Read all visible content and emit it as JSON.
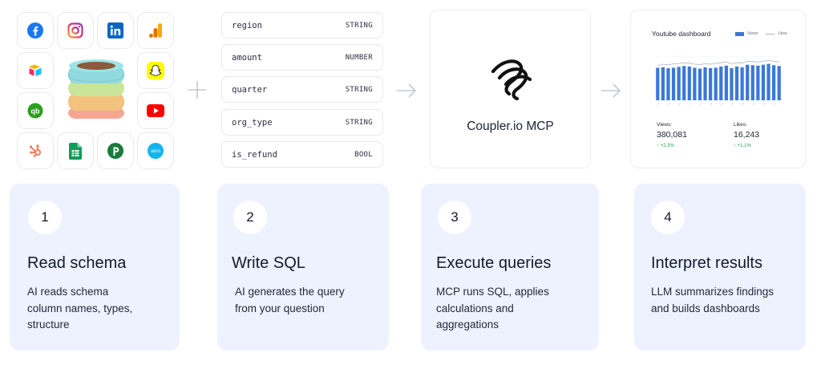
{
  "schema_fields": [
    {
      "name": "region",
      "type": "STRING"
    },
    {
      "name": "amount",
      "type": "NUMBER"
    },
    {
      "name": "quarter",
      "type": "STRING"
    },
    {
      "name": "org_type",
      "type": "STRING"
    },
    {
      "name": "is_refund",
      "type": "BOOL"
    }
  ],
  "source_icons": [
    "facebook-icon",
    "instagram-icon",
    "linkedin-icon",
    "google-analytics-icon",
    "airtable-icon",
    "snapchat-icon",
    "quickbooks-icon",
    "youtube-icon",
    "hubspot-icon",
    "google-sheets-icon",
    "pipedrive-icon",
    "xero-icon"
  ],
  "mcp": {
    "name": "Coupler.io MCP"
  },
  "dashboard": {
    "title": "Youtube dashboard",
    "legend": {
      "views": "Views",
      "likes": "Likes"
    },
    "views_label": "Views:",
    "views_value": "380,081",
    "views_delta": "↑ +2.3%",
    "likes_label": "Likes:",
    "likes_value": "16,243",
    "likes_delta": "↑ +1.1%"
  },
  "chart_data": {
    "type": "bar",
    "title": "Youtube dashboard",
    "series": [
      {
        "name": "Views",
        "values": [
          150,
          152,
          148,
          150,
          154,
          158,
          156,
          150,
          146,
          152,
          148,
          150,
          156,
          160,
          148,
          156,
          152,
          164,
          162,
          160,
          164,
          168,
          162,
          158
        ]
      },
      {
        "name": "Likes",
        "values": [
          480,
          500,
          490,
          505,
          510,
          520,
          515,
          500,
          495,
          505,
          500,
          510,
          520,
          530,
          505,
          520,
          515,
          540,
          535,
          530,
          540,
          550,
          540,
          530
        ]
      }
    ],
    "ylim_left": [
      0,
      200
    ],
    "ylim_right": [
      0,
      600
    ],
    "grid": true,
    "legend_position": "top-right",
    "colors": {
      "views": "#3a78d8",
      "likes": "#aab4c8"
    }
  },
  "steps": [
    {
      "number": "1",
      "title": "Read schema",
      "desc_lines": [
        "AI reads schema",
        "column names, types,",
        "structure"
      ]
    },
    {
      "number": "2",
      "title": "Write SQL",
      "desc_lines": [
        "AI generates the query",
        "from your question"
      ]
    },
    {
      "number": "3",
      "title": "Execute queries",
      "desc_lines": [
        "MCP runs SQL, applies",
        "calculations and",
        "aggregations"
      ]
    },
    {
      "number": "4",
      "title": "Interpret results",
      "desc_lines": [
        "LLM summarizes findings",
        "and builds dashboards"
      ]
    }
  ],
  "colors": {
    "card_bg": "#eef2fe",
    "accent_green": "#22a05a",
    "bar_blue": "#3a78d8"
  }
}
